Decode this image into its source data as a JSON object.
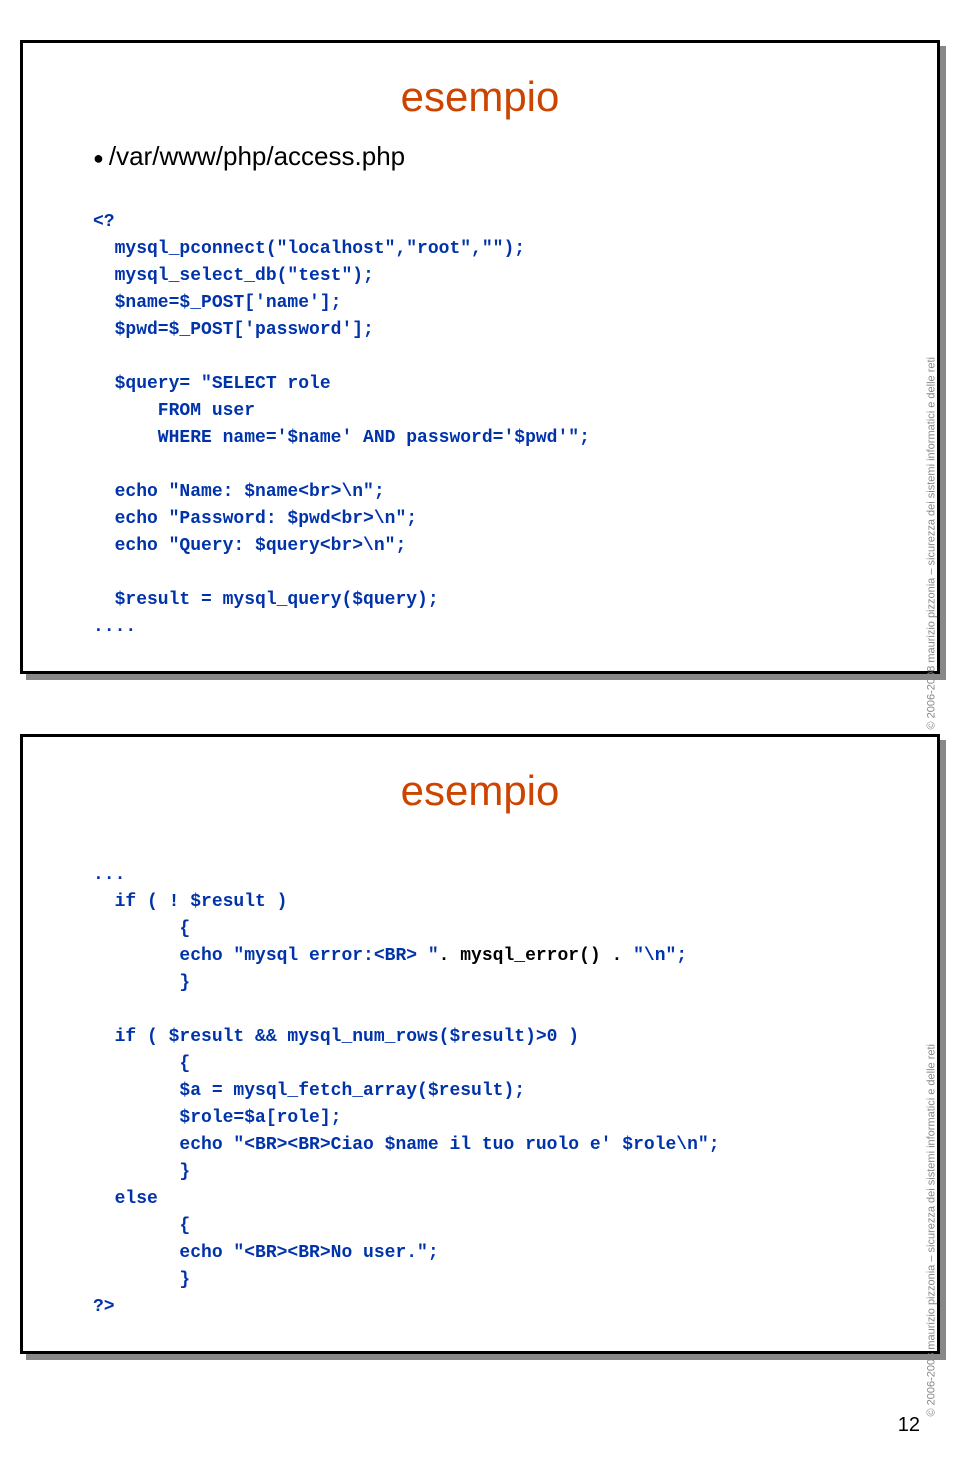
{
  "slide1": {
    "title": "esempio",
    "bullet": "/var/www/php/access.php",
    "side": "© 2006-2008 maurizio pizzonia – sicurezza dei sistemi informatici e delle reti",
    "code": {
      "l1": "<?",
      "l2": "  mysql_pconnect(\"localhost\",\"root\",\"\");",
      "l3": "  mysql_select_db(\"test\");",
      "l4": "  $name=$_POST['name'];",
      "l5": "  $pwd=$_POST['password'];",
      "l6": "",
      "l7": "  $query= \"SELECT role ",
      "l8": "      FROM user ",
      "l9": "      WHERE name='$name' AND password='$pwd'\";",
      "l10": "",
      "l11": "  echo \"Name: $name<br>\\n\";",
      "l12": "  echo \"Password: $pwd<br>\\n\";",
      "l13": "  echo \"Query: $query<br>\\n\";",
      "l14": "",
      "l15": "  $result = mysql_query($query);",
      "l16": "...."
    }
  },
  "slide2": {
    "title": "esempio",
    "side": "© 2006-2008 maurizio pizzonia – sicurezza dei sistemi informatici e delle reti",
    "code": {
      "l1": "...",
      "l2": "  if ( ! $result )",
      "l3": "        {",
      "l4a": "        echo \"mysql error:<BR> \"",
      "l4b": ". mysql_error() .",
      "l4c": " \"\\n\";",
      "l5": "        }",
      "l6": "",
      "l7": "  if ( $result && mysql_num_rows($result)>0 )",
      "l8": "        {",
      "l9": "        $a = mysql_fetch_array($result);",
      "l10": "        $role=$a[role];",
      "l11": "        echo \"<BR><BR>Ciao $name il tuo ruolo e' $role\\n\";",
      "l12": "        }",
      "l13": "  else",
      "l14": "        {",
      "l15": "        echo \"<BR><BR>No user.\";",
      "l16": "        }",
      "l17": "?>"
    }
  },
  "page": "12"
}
